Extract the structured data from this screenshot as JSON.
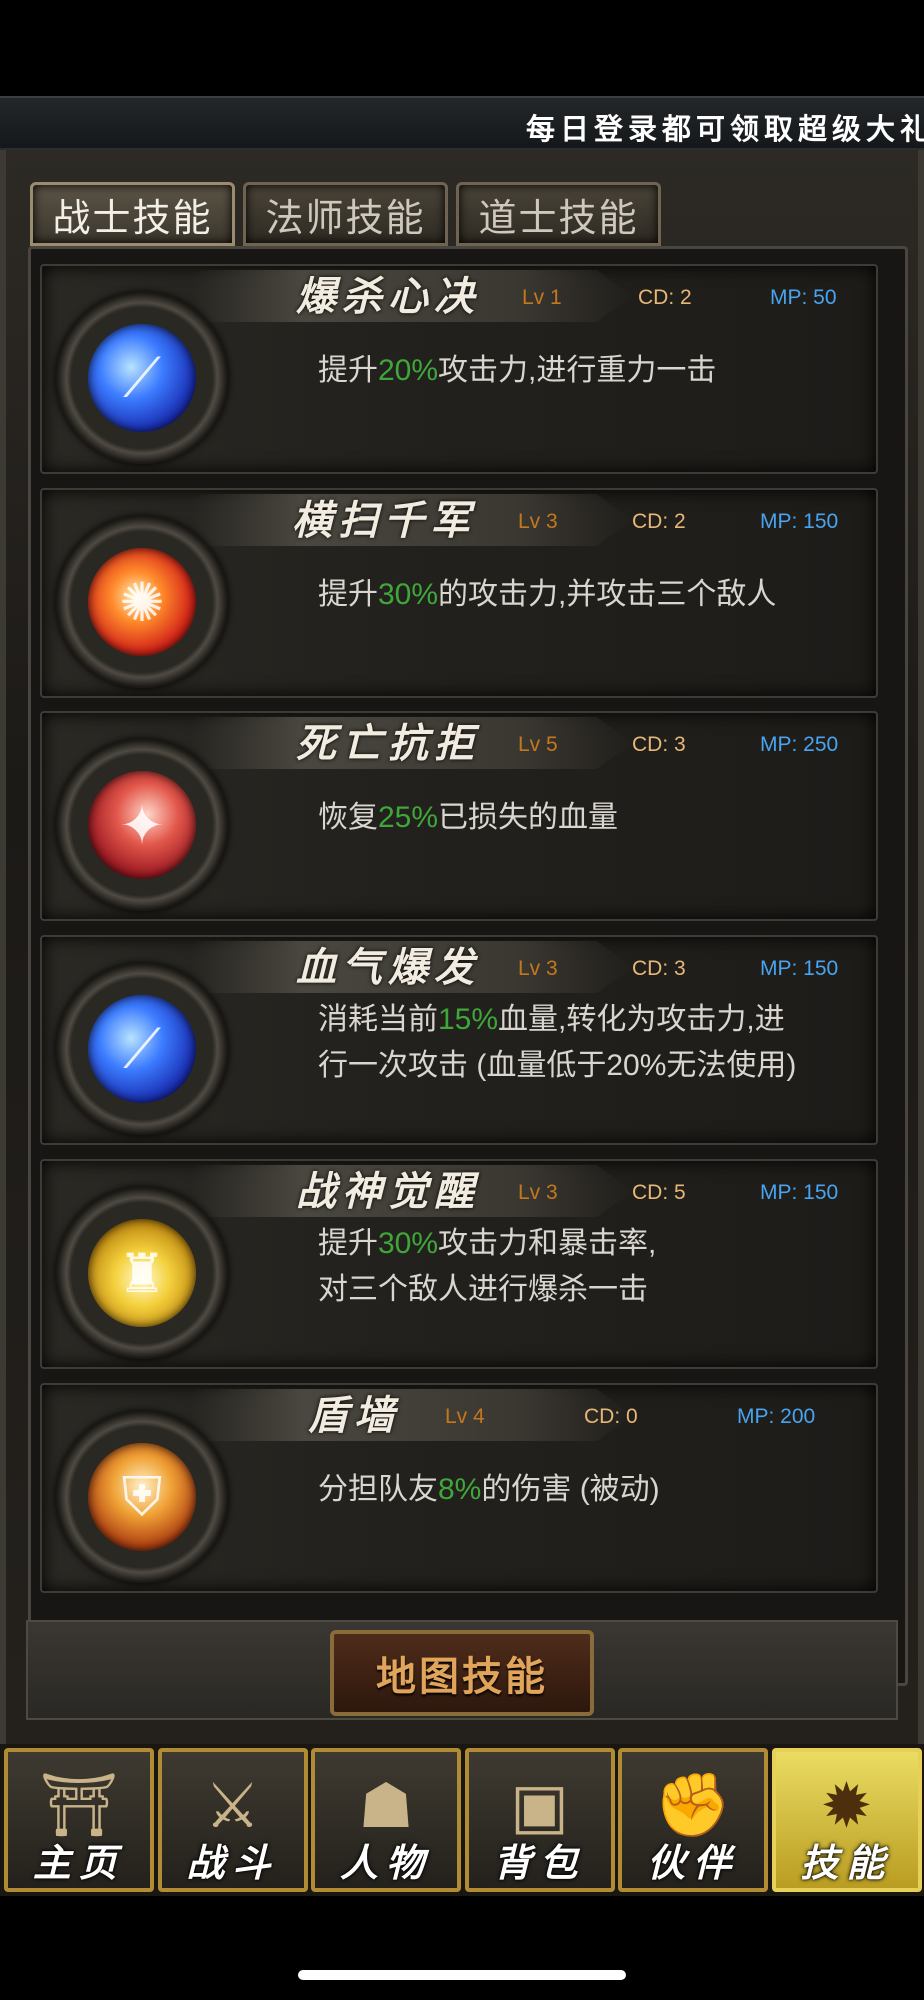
{
  "marquee": {
    "text": "每日登录都可领取超级大礼包"
  },
  "tabs": [
    {
      "label": "战士技能",
      "active": true
    },
    {
      "label": "法师技能",
      "active": false
    },
    {
      "label": "道士技能",
      "active": false
    }
  ],
  "skills": [
    {
      "name": "爆杀心决",
      "lv": "Lv 1",
      "cd": "CD: 2",
      "mp": "MP: 50",
      "icon": "blue-slash-icon",
      "desc": [
        {
          "pre": "提升",
          "hl": "20%",
          "post": "攻击力,进行重力一击"
        }
      ]
    },
    {
      "name": "横扫千军",
      "lv": "Lv 3",
      "cd": "CD: 2",
      "mp": "MP: 150",
      "icon": "fire-sweep-icon",
      "desc": [
        {
          "pre": "提升",
          "hl": "30%",
          "post": "的攻击力,并攻击三个敌人"
        }
      ]
    },
    {
      "name": "死亡抗拒",
      "lv": "Lv 5",
      "cd": "CD: 3",
      "mp": "MP: 250",
      "icon": "blood-shield-icon",
      "desc": [
        {
          "pre": "恢复",
          "hl": "25%",
          "post": "已损失的血量"
        }
      ]
    },
    {
      "name": "血气爆发",
      "lv": "Lv 3",
      "cd": "CD: 3",
      "mp": "MP: 150",
      "icon": "blue-slash-icon",
      "desc": [
        {
          "pre": "消耗当前",
          "hl": "15%",
          "post": "血量,转化为攻击力,进"
        },
        {
          "pre": "行一次攻击 (血量低于20%无法使用)",
          "hl": "",
          "post": ""
        }
      ]
    },
    {
      "name": "战神觉醒",
      "lv": "Lv 3",
      "cd": "CD: 5",
      "mp": "MP: 150",
      "icon": "golden-warrior-icon",
      "desc": [
        {
          "pre": "提升",
          "hl": "30%",
          "post": "攻击力和暴击率,"
        },
        {
          "pre": "对三个敌人进行爆杀一击",
          "hl": "",
          "post": ""
        }
      ]
    },
    {
      "name": "盾墙",
      "lv": "Lv 4",
      "cd": "CD: 0",
      "mp": "MP: 200",
      "icon": "helmet-shield-icon",
      "desc": [
        {
          "pre": "分担队友",
          "hl": "8%",
          "post": "的伤害 (被动)"
        }
      ]
    }
  ],
  "map_button": {
    "label": "地图技能"
  },
  "nav": [
    {
      "label": "主页",
      "icon": "castle-icon",
      "active": false
    },
    {
      "label": "战斗",
      "icon": "crossed-swords-icon",
      "active": false
    },
    {
      "label": "人物",
      "icon": "warrior-helmet-icon",
      "active": false
    },
    {
      "label": "背包",
      "icon": "backpack-icon",
      "active": false
    },
    {
      "label": "伙伴",
      "icon": "handshake-icon",
      "active": false
    },
    {
      "label": "技能",
      "icon": "skill-book-icon",
      "active": true
    }
  ],
  "colors": {
    "highlight_green": "#3fa63a",
    "level_orange": "#c4781e",
    "cd_tan": "#e7b777",
    "mp_blue": "#48a4ef",
    "active_nav_gold": "#eadc62"
  }
}
